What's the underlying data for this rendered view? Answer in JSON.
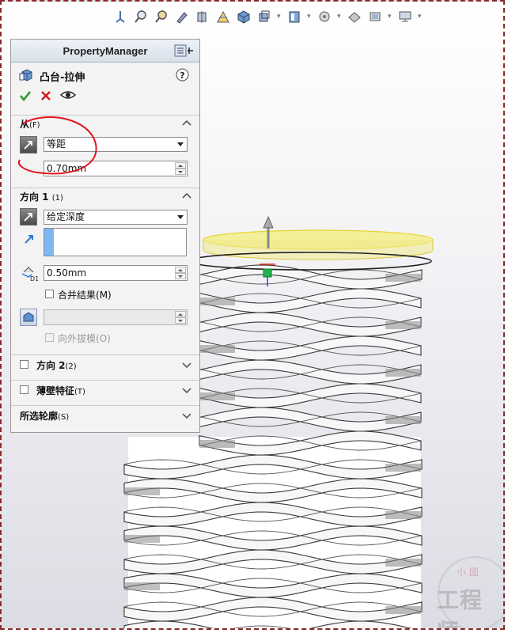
{
  "toolbar": {
    "icons": [
      "view-orientation-icon",
      "zoom-fit-icon",
      "zoom-area-icon",
      "previous-view-icon",
      "section-view-icon",
      "dynamic-annotation-icon",
      "view-orientation-cube-icon",
      "display-style-icon",
      "hide-show-icon",
      "edit-appearance-icon",
      "apply-scene-icon",
      "view-settings-icon"
    ]
  },
  "property_manager": {
    "title": "PropertyManager",
    "feature_name": "凸台-拉伸",
    "help_icon": "?",
    "from_section": {
      "label": "从",
      "shortcut": "(F)",
      "type_value": "等距",
      "offset_value": "0.70mm"
    },
    "direction1": {
      "label": "方向 1",
      "shortcut": "(1)",
      "end_condition": "给定深度",
      "depth_value": "0.50mm",
      "merge_label": "合并结果",
      "merge_shortcut": "(M)",
      "draft_value": "",
      "draft_outward_label": "向外拔模",
      "draft_outward_shortcut": "(O)"
    },
    "direction2": {
      "label": "方向 2",
      "shortcut": "(2)"
    },
    "thin_feature": {
      "label": "薄壁特征",
      "shortcut": "(T)"
    },
    "selected_contours": {
      "label": "所选轮廓",
      "shortcut": "(S)"
    }
  },
  "watermark": {
    "small": "小 國",
    "text": "工程师"
  },
  "colors": {
    "preview_yellow": "#f2ef7a",
    "accent_blue": "#7fb8f0",
    "annotation_red": "#e0141b"
  }
}
